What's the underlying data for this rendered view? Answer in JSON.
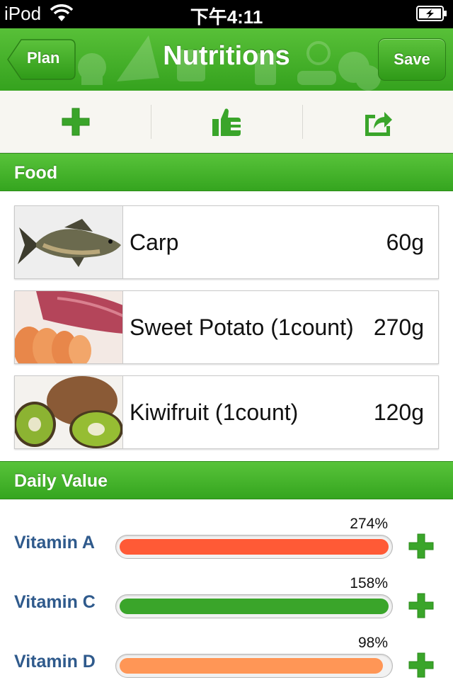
{
  "status_bar": {
    "carrier": "iPod",
    "time": "下午4:11"
  },
  "nav": {
    "back_label": "Plan",
    "title": "Nutritions",
    "save_label": "Save"
  },
  "toolbar": {
    "items": [
      {
        "icon": "plus-icon"
      },
      {
        "icon": "thumbs-up-icon"
      },
      {
        "icon": "share-icon"
      }
    ]
  },
  "food_section": {
    "title": "Food",
    "items": [
      {
        "name": "Carp",
        "amount": "60g",
        "image": "carp-fish-image"
      },
      {
        "name": "Sweet Potato (1count)",
        "amount": "270g",
        "image": "sweet-potato-image"
      },
      {
        "name": "Kiwifruit (1count)",
        "amount": "120g",
        "image": "kiwifruit-image"
      }
    ]
  },
  "daily_value": {
    "title": "Daily Value",
    "items": [
      {
        "label": "Vitamin A",
        "percent": "274%",
        "fill": 1.0,
        "color": "#ff5a36"
      },
      {
        "label": "Vitamin C",
        "percent": "158%",
        "fill": 1.0,
        "color": "#3aa52a"
      },
      {
        "label": "Vitamin D",
        "percent": "98%",
        "fill": 0.98,
        "color": "#ff9656"
      }
    ]
  },
  "colors": {
    "accent_green": "#3aa52a",
    "label_blue": "#2f5a8c"
  }
}
